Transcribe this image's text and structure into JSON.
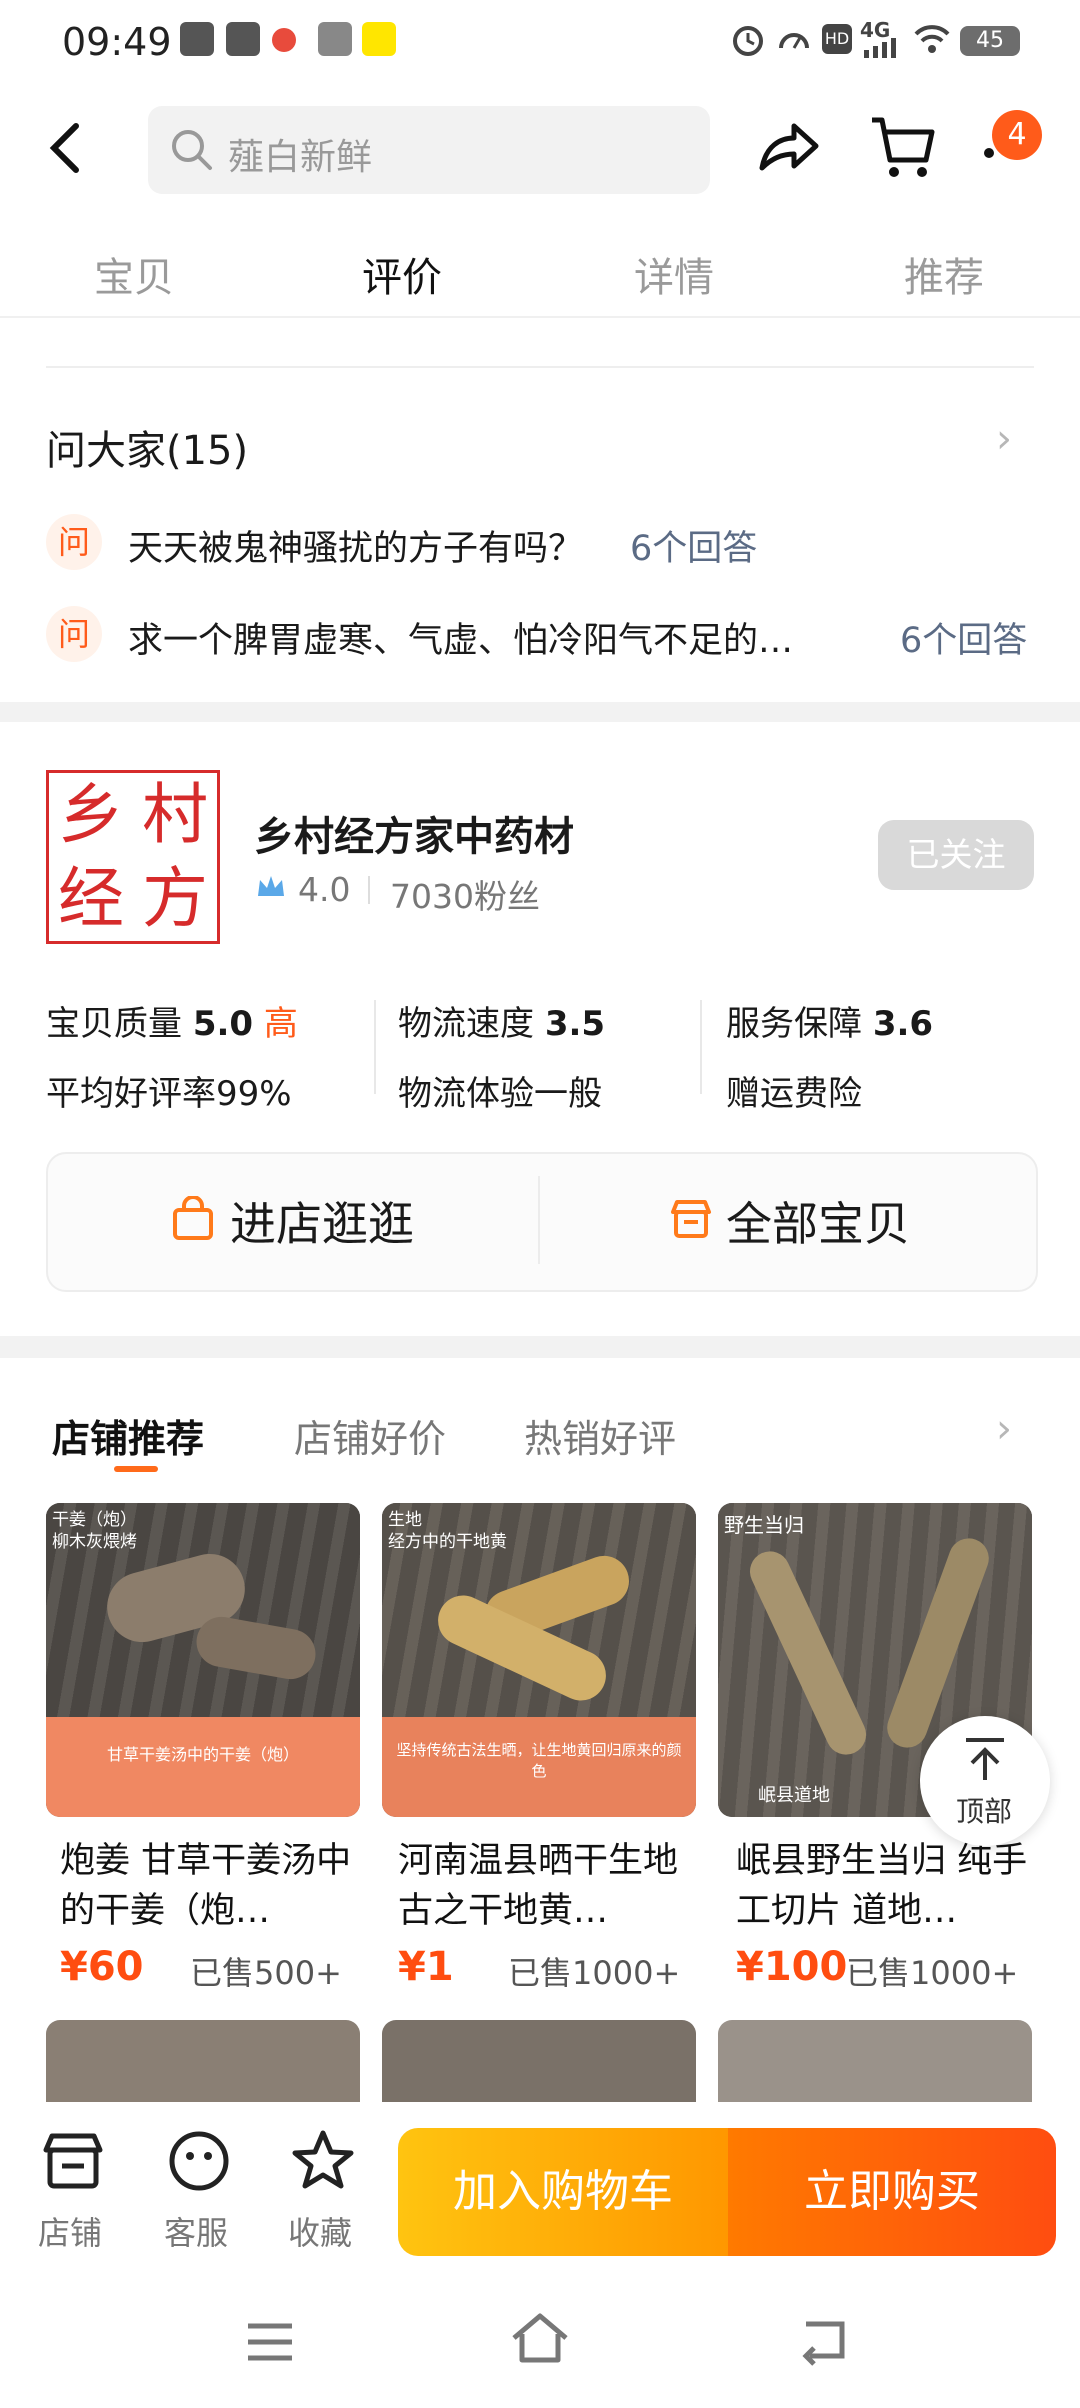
{
  "status_bar": {
    "time": "09:49",
    "battery": "45",
    "network": "4G"
  },
  "header": {
    "search_placeholder": "薤白新鲜",
    "cart_badge": "4"
  },
  "tabs": [
    "宝贝",
    "评价",
    "详情",
    "推荐"
  ],
  "ask": {
    "title": "问大家(15)",
    "badge": "问",
    "questions": [
      {
        "q": "天天被鬼神骚扰的方子有吗？",
        "answers": "6个回答"
      },
      {
        "q": "求一个脾胃虚寒、气虚、怕冷阳气不足的…",
        "answers": "6个回答"
      }
    ]
  },
  "store": {
    "logo_text": "乡村经方",
    "name": "乡村经方家中药材",
    "rating": "4.0",
    "fans": "7030粉丝",
    "follow_label": "已关注",
    "metrics": [
      {
        "label": "宝贝质量",
        "value": "5.0",
        "tag": "高",
        "sub": "平均好评率99%"
      },
      {
        "label": "物流速度",
        "value": "3.5",
        "tag": "",
        "sub": "物流体验一般"
      },
      {
        "label": "服务保障",
        "value": "3.6",
        "tag": "",
        "sub": "赠运费险"
      }
    ],
    "enter_label": "进店逛逛",
    "all_items_label": "全部宝贝"
  },
  "recommend": {
    "tabs": [
      "店铺推荐",
      "店铺好价",
      "热销好评"
    ],
    "products": [
      {
        "image_label": "干姜（炮）\n柳木灰煨烤",
        "title": "炮姜  甘草干姜汤中的干姜（炮…",
        "price": "¥60",
        "sold": "已售500+",
        "image_caption": "甘草干姜汤中的干姜（炮）"
      },
      {
        "image_label": "生地\n经方中的干地黄",
        "title": "河南温县晒干生地 古之干地黄…",
        "price": "¥1",
        "sold": "已售1000+",
        "image_caption": "坚持传统古法生晒，让生地黄回归原来的颜色"
      },
      {
        "image_label": "野生当归",
        "title": "岷县野生当归 纯手工切片  道地…",
        "price": "¥100",
        "sold": "已售1000+",
        "image_caption": "岷县道地"
      }
    ],
    "top_button": "顶部"
  },
  "bottom_bar": {
    "store_label": "店铺",
    "service_label": "客服",
    "favorite_label": "收藏",
    "add_cart_label": "加入购物车",
    "buy_now_label": "立即购买"
  }
}
